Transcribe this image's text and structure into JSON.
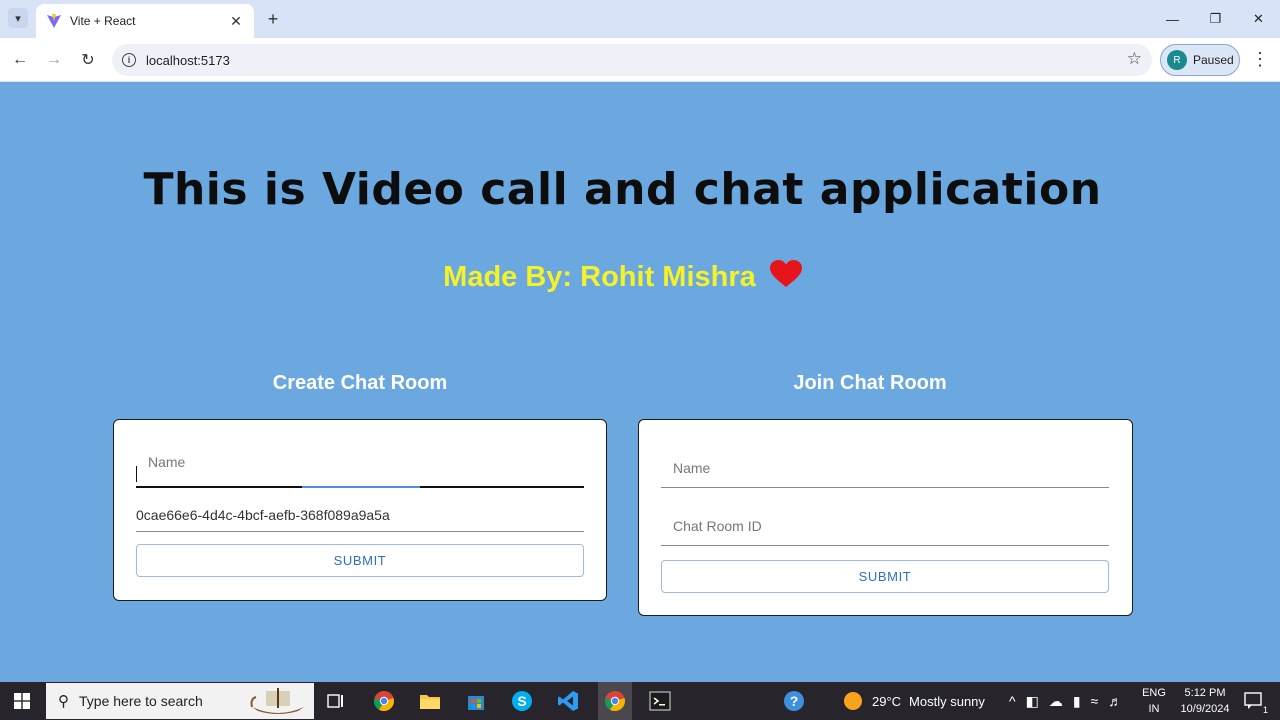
{
  "browser": {
    "tab_title": "Vite + React",
    "url": "localhost:5173",
    "profile_initial": "R",
    "profile_status": "Paused"
  },
  "page": {
    "title": "This is Video call and chat application",
    "subtitle": "Made By: Rohit Mishra",
    "create": {
      "heading": "Create Chat Room",
      "name_placeholder": "Name",
      "room_id_value": "0cae66e6-4d4c-4bcf-aefb-368f089a9a5a",
      "submit_label": "SUBMIT"
    },
    "join": {
      "heading": "Join Chat Room",
      "name_placeholder": "Name",
      "room_id_placeholder": "Chat Room ID",
      "submit_label": "SUBMIT"
    }
  },
  "taskbar": {
    "search_placeholder": "Type here to search",
    "weather_temp": "29°C",
    "weather_desc": "Mostly sunny",
    "lang_line1": "ENG",
    "lang_line2": "IN",
    "time": "5:12 PM",
    "date": "10/9/2024",
    "notification_count": "1"
  },
  "colors": {
    "page_bg": "#6aa8df",
    "subtitle": "#f5f229",
    "heart": "#e8141c",
    "button_text": "#2f6fc1"
  }
}
